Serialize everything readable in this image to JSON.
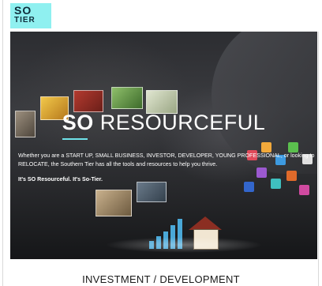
{
  "logo": {
    "line1": "SO",
    "line2": "TIER"
  },
  "hero": {
    "title_bold": "SO",
    "title_rest": " RESOURCEFUL",
    "description": "Whether you are a START UP, SMALL BUSINESS, INVESTOR, DEVELOPER, YOUNG PROFESSIONAL, or looking to RELOCATE, the Southern Tier has all the tools and resources to help you thrive.",
    "tagline": "It's SO Resourceful. It's So-Tier."
  },
  "section": {
    "heading": "INVESTMENT / DEVELOPMENT"
  },
  "colors": {
    "logo_bg": "#8ff0f0",
    "accent_underline": "#6fe3ea",
    "logo_text": "#0f2c3a"
  }
}
